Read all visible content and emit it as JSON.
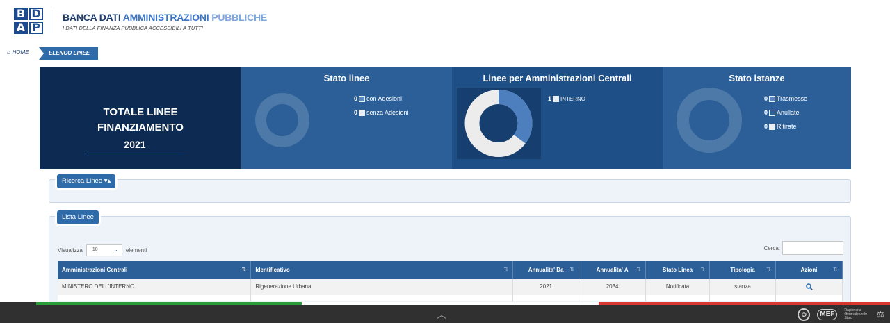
{
  "header": {
    "logo": [
      "B",
      "D",
      "A",
      "P"
    ],
    "brand_part1": "BANCA DATI ",
    "brand_part2": "AMMINISTRAZIONI ",
    "brand_part3": "PUBBLICHE",
    "tagline": "I DATI DELLA FINANZA PUBBLICA ACCESSIBILI A TUTTI"
  },
  "breadcrumb": {
    "home": "HOME",
    "current": "ELENCO LINEE"
  },
  "dashboard": {
    "total": {
      "title_line1": "TOTALE LINEE",
      "title_line2": "FINANZIAMENTO",
      "year": "2021"
    },
    "stato_linee": {
      "title": "Stato linee",
      "items": [
        {
          "count": "0",
          "label": "con Adesioni"
        },
        {
          "count": "0",
          "label": "senza Adesioni"
        }
      ]
    },
    "linee_amministrazioni": {
      "title": "Linee per Amministrazioni Centrali",
      "items": [
        {
          "count": "1",
          "label": "INTERNO"
        }
      ]
    },
    "stato_istanze": {
      "title": "Stato istanze",
      "items": [
        {
          "count": "0",
          "label": "Trasmesse"
        },
        {
          "count": "0",
          "label": "Anullate"
        },
        {
          "count": "0",
          "label": "Ritirate"
        }
      ]
    }
  },
  "search": {
    "tab_label": "Ricerca Linee ▾▴"
  },
  "list": {
    "tab_label": "Lista Linee",
    "show_prefix": "Visualizza",
    "page_size": "10",
    "show_suffix": "elementi",
    "search_label": "Cerca:",
    "columns": [
      "Amministrazioni Centrali",
      "Identificativo",
      "Annualita' Da",
      "Annualita' A",
      "Stato Linea",
      "Tipologia",
      "Azioni"
    ],
    "rows": [
      {
        "amministrazione": "MINISTERO DELL'INTERNO",
        "identificativo": "Rigenerazione Urbana",
        "da": "2021",
        "a": "2034",
        "stato": "Notificata",
        "tipologia": "stanza"
      }
    ]
  },
  "footer": {
    "rgs": "Ragioneria Generale dello Stato",
    "mef": "MEF"
  },
  "colors": {
    "navy": "#0c2a52",
    "panel_blue": "#2c5f97",
    "accent_blue": "#2f6aa9",
    "flag_green": "#2a9d3a",
    "flag_red": "#d6392e"
  }
}
